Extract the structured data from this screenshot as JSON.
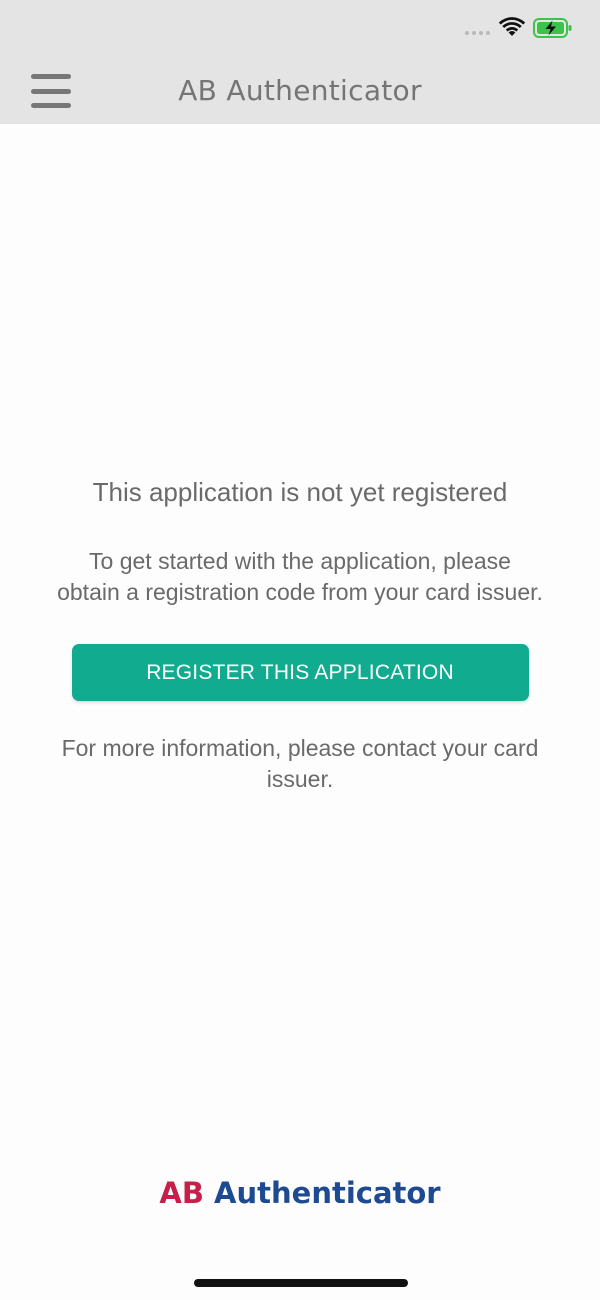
{
  "header": {
    "title": "AB Authenticator",
    "menu_icon": "hamburger-menu-icon"
  },
  "status_bar": {
    "icons": [
      "cellular-signal-icon",
      "wifi-icon",
      "battery-charging-icon"
    ],
    "battery_color": "#3cc34a"
  },
  "main": {
    "headline": "This application is not yet registered",
    "instructions": "To get started with the application, please obtain a registration code from your card issuer.",
    "register_button_label": "REGISTER THIS APPLICATION",
    "more_info": "For more information, please contact your card issuer."
  },
  "footer": {
    "logo_part1": "AB",
    "logo_part2": "Authenticator"
  },
  "colors": {
    "accent": "#11ac90",
    "header_bg": "#e4e4e4",
    "logo_red": "#c51f4a",
    "logo_blue": "#1e4a91"
  }
}
